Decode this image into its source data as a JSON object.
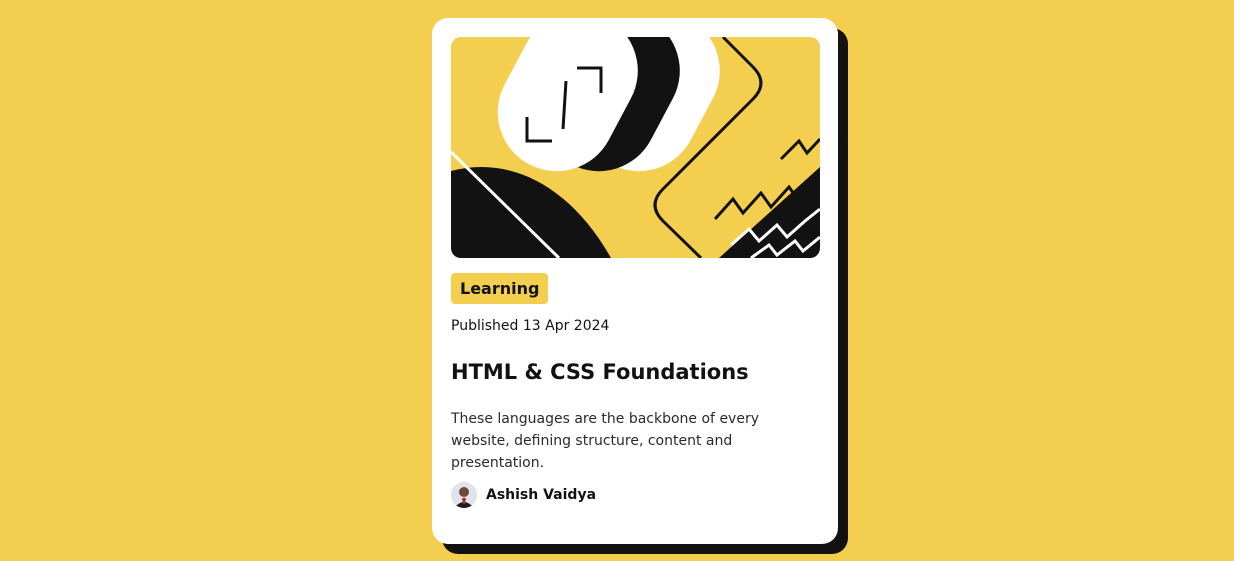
{
  "card": {
    "tag": "Learning",
    "published": "Published 13 Apr 2024",
    "title": "HTML & CSS Foundations",
    "description": "These languages are the backbone of every website, defining structure, content and presentation.",
    "author": {
      "name": "Ashish Vaidya",
      "avatar_icon": "avatar-photo"
    },
    "hero_illustration": "abstract-illustration-icon"
  },
  "colors": {
    "background": "#F4CE4E",
    "card": "#FFFFFF",
    "ink": "#121212",
    "accent": "#F4CE4E"
  }
}
